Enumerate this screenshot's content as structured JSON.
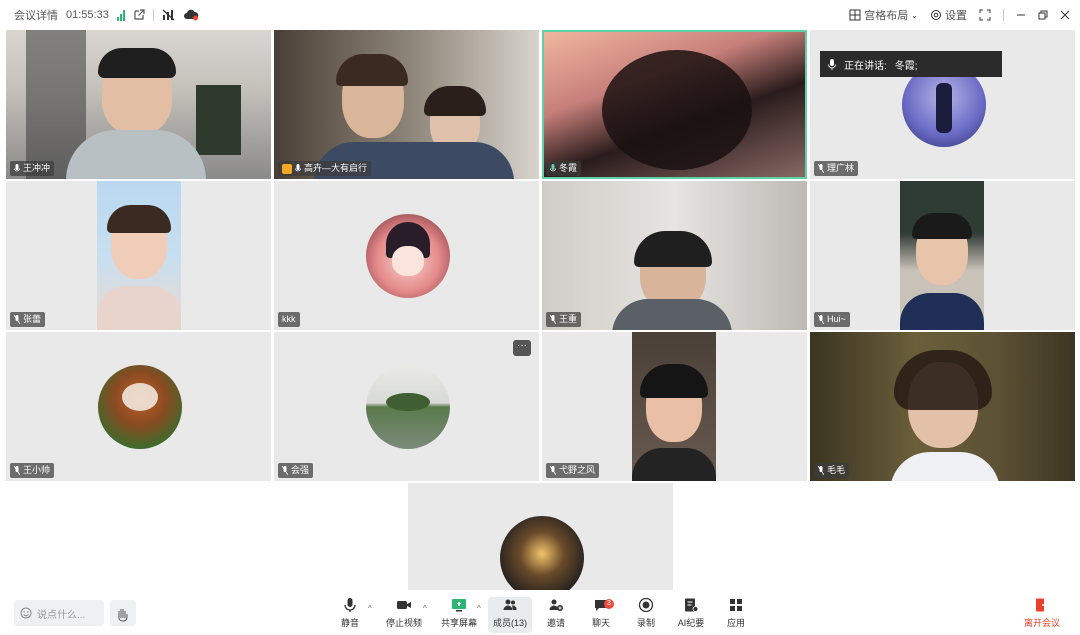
{
  "topbar": {
    "meeting_details": "会议详情",
    "timer": "01:55:33",
    "layout_label": "宫格布局",
    "settings_label": "设置"
  },
  "speaking": {
    "prefix": "正在讲话:",
    "name": "冬霞;"
  },
  "participants": [
    {
      "name": "王冲冲"
    },
    {
      "name": "高卉—大有启行"
    },
    {
      "name": "冬霞"
    },
    {
      "name": "理广林"
    },
    {
      "name": "张蕾"
    },
    {
      "name": "kkk"
    },
    {
      "name": "王重"
    },
    {
      "name": "Hui~"
    },
    {
      "name": "王小帅"
    },
    {
      "name": "会强"
    },
    {
      "name": "弋野之风"
    },
    {
      "name": "毛毛"
    }
  ],
  "bottombar": {
    "chat_placeholder": "说点什么...",
    "mute": "静音",
    "stop_video": "停止视频",
    "share_screen": "共享屏幕",
    "members": "成员(13)",
    "invite": "邀请",
    "chat": "聊天",
    "chat_badge": "3",
    "record": "录制",
    "ai_minutes": "AI纪要",
    "apps": "应用",
    "leave": "离开会议"
  },
  "colors": {
    "accent": "#2bb673",
    "active_border": "#5fd1a7",
    "leave": "#e8412c"
  }
}
